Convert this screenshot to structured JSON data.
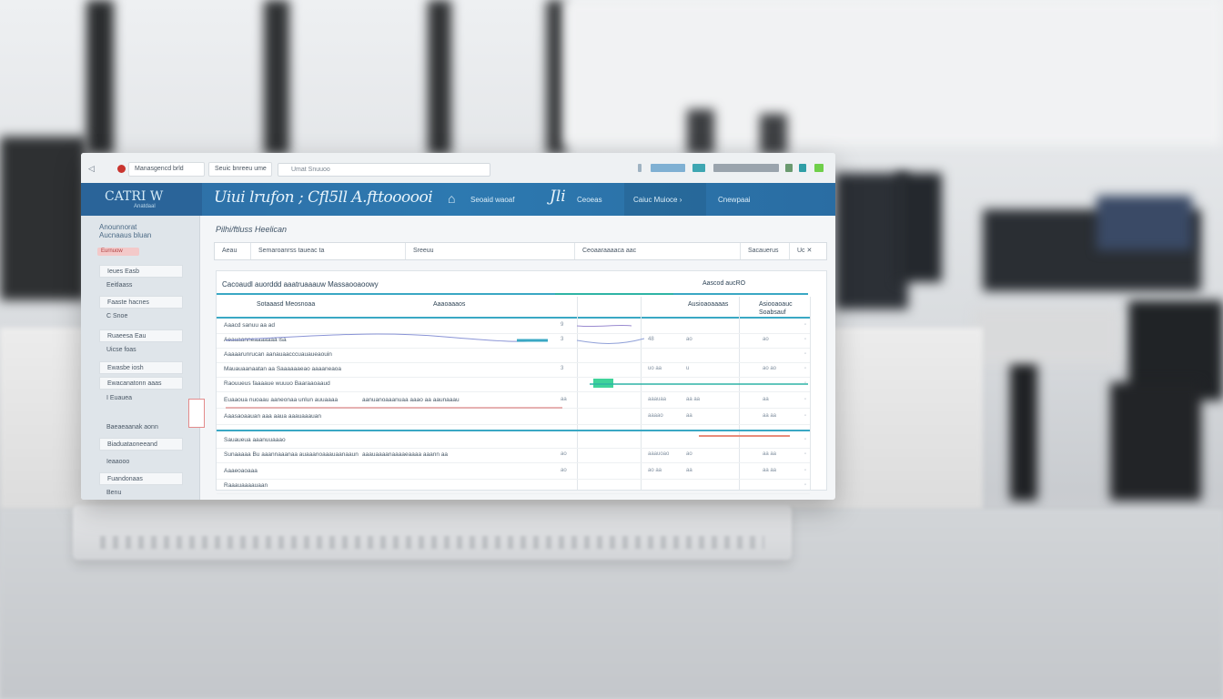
{
  "topbar": {
    "back_glyph": "◁",
    "tab1": "Manasgencd brld",
    "tab2": "Seuic bnreeu ume",
    "search_placeholder": "Umat Snuuoo"
  },
  "hero": {
    "brand_main": "CATRI W",
    "brand_sub": "Anatdaal",
    "title": "Uiui lrufon  ;  Cfl5ll A.fttoooooi",
    "title_icon": "⌂",
    "label1": "Seoaid waoaf",
    "big": "Jli",
    "label2": "Ceoeas",
    "label3": "Caiuc Muioce  ›",
    "label4": "Cnewpaai"
  },
  "sidebar": {
    "header": "Anounnorat Aucnaaus bluan",
    "badge": "Eurnuow",
    "items": [
      "Ieues Easb",
      "Eeitlaass",
      "Faaste hacnes",
      "C  Snoe",
      "Ruaeesa Eau",
      "Uicse foas",
      "Ewasbe iosh",
      "Ewacanatonn aaas",
      "I  Euauea",
      "Baeaeaanak aonn",
      "Biaduataoneeand",
      "Ieaaooo",
      "Fuandonaas"
    ],
    "footer": "Benu"
  },
  "main": {
    "breadcrumb": "Pilhi/ftluss Heelican",
    "filters": [
      "Aeau",
      "Semaroanrss  taueac  ta",
      "Sreeuu",
      "Ceoaaraaaaca aac",
      "Sacauerus",
      "Uc  ✕"
    ],
    "panel_title": "Cacoaudl auorddd aaatruaaauw Massaooaoowy",
    "panel_right": "Aascod aucRO",
    "headers": [
      "Sotaaasd Meosnoaa",
      "Aaaoaaaos",
      "Ausioaoaaaas",
      "Asiooaoauc",
      "Soabsauf"
    ],
    "rows": [
      {
        "a": "Aaacd sanuu aa ad",
        "b": "",
        "n1": "9",
        "n2": "",
        "n3": "",
        "n4": ""
      },
      {
        "a": "Aeauaanneaaaaaaa lsa",
        "b": "",
        "n1": "3",
        "n2": "48",
        "n3": "ao",
        "n4": "ao"
      },
      {
        "a": "Aaaaarunrucan aanauaacccuauaueaouin",
        "b": "",
        "n1": "",
        "n2": "",
        "n3": "",
        "n4": ""
      },
      {
        "a": "Mauauaanaatan aa Saaaaaaeao aaaaneaoa",
        "b": "",
        "n1": "3",
        "n2": "uo  aa",
        "n3": "u",
        "n4": "ao  ao"
      },
      {
        "a": "Raouueus faaaaue wuuuo Baaraaoaaud",
        "b": "",
        "n1": "",
        "n2": "",
        "n3": "",
        "n4": ""
      },
      {
        "a": "Euaaoua nuoaau aaneonaa unlun auuaaaa",
        "b": "aanuanoaaanuaa aaao aa aaunaaau",
        "n1": "aa",
        "n2": "aaauaa",
        "n3": "aa  aa",
        "n4": "aa"
      },
      {
        "a": "Aaasaoaauan aaa aaua aaauaaauan",
        "b": "",
        "n1": "",
        "n2": "aaaao",
        "n3": "aa",
        "n4": "aa  aa"
      },
      {
        "a": "Sauaueua aaanuuaaao",
        "b": "",
        "n1": "",
        "n2": "",
        "n3": "",
        "n4": ""
      },
      {
        "a": "Sunaaaaa Bu aaannaaanaa auaaanoaaauaanaaun",
        "b": "aaauaaaanaaaaeaaaa aaann aa",
        "n1": "ao",
        "n2": "aaauoao",
        "n3": "ao",
        "n4": "aa  aa"
      },
      {
        "a": "Aaaeoaoaaa",
        "b": "",
        "n1": "ao",
        "n2": "ao  aa",
        "n3": "aa",
        "n4": "aa  aa"
      },
      {
        "a": "Raaauaaaauaan",
        "b": "",
        "n1": "",
        "n2": "",
        "n3": "",
        "n4": ""
      }
    ]
  },
  "colors": {
    "accent": "#3aa8c4",
    "hero": "#2d79b0",
    "alert": "#c9352f",
    "success": "#3fd39a"
  }
}
